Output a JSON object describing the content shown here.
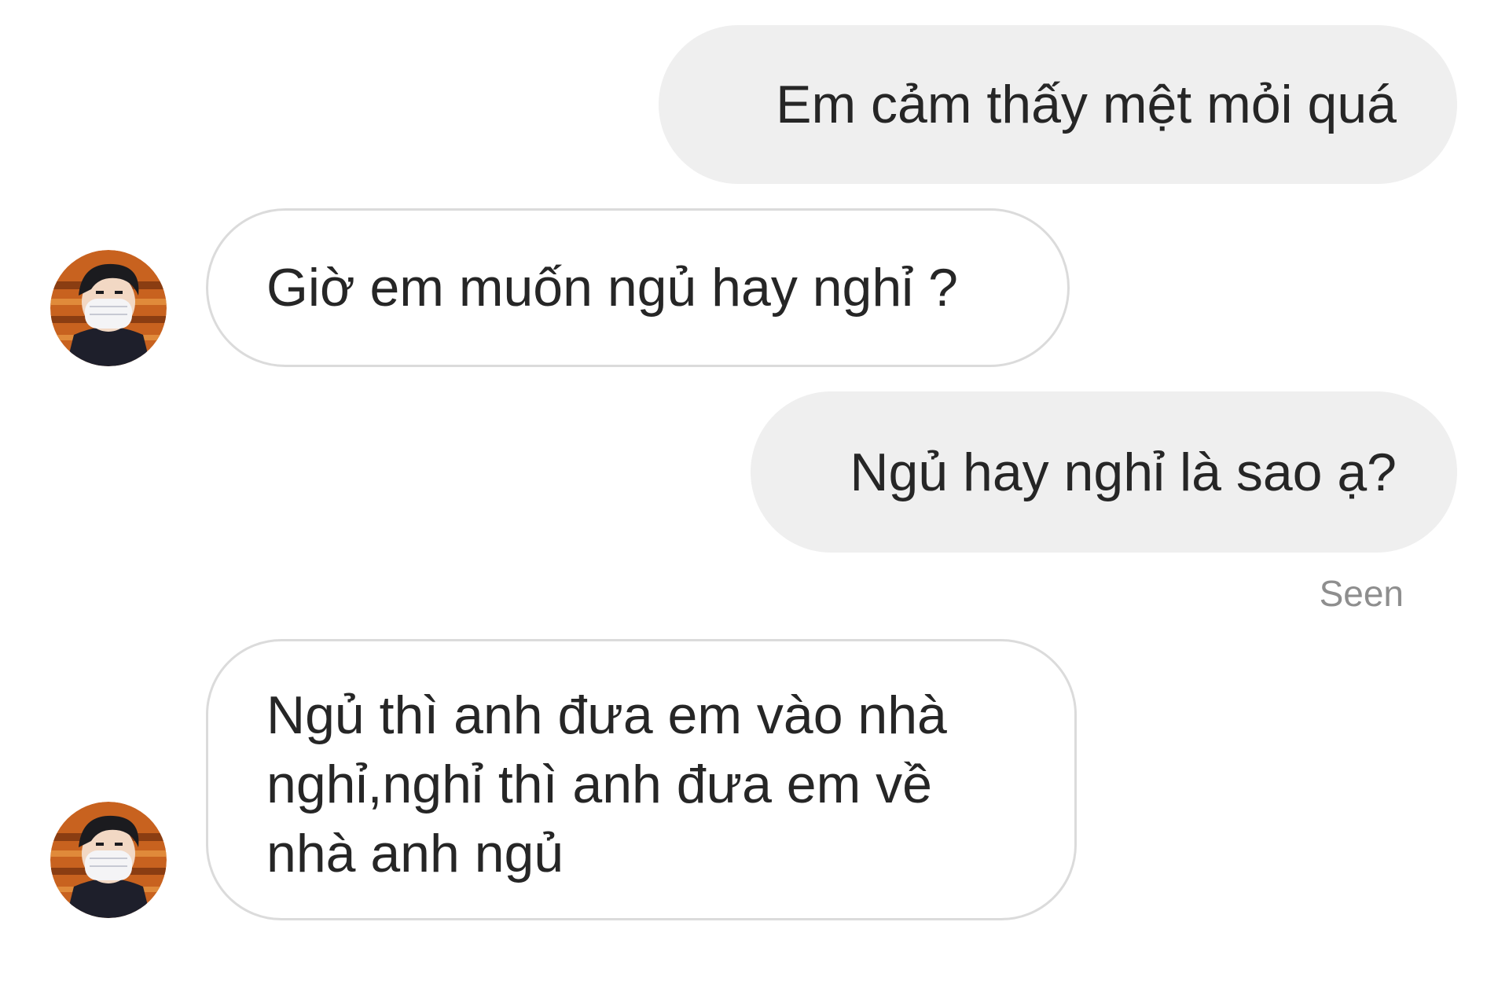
{
  "messages": [
    {
      "side": "sent",
      "text": "Em cảm thấy mệt mỏi quá"
    },
    {
      "side": "received",
      "text": "Giờ em muốn ngủ hay nghỉ ?"
    },
    {
      "side": "sent",
      "text": "Ngủ hay nghỉ là sao ạ?"
    },
    {
      "side": "received",
      "lines": [
        "Ngủ thì anh đưa em vào nhà",
        "nghỉ,nghỉ thì anh đưa em về",
        "nhà anh ngủ"
      ]
    }
  ],
  "status": {
    "seen_label": "Seen"
  },
  "colors": {
    "sent_bubble": "#efefef",
    "received_border": "#dbdbdb",
    "text": "#262626",
    "seen_text": "#8e8e8e"
  },
  "icons": {
    "avatar": "user-avatar-icon"
  }
}
